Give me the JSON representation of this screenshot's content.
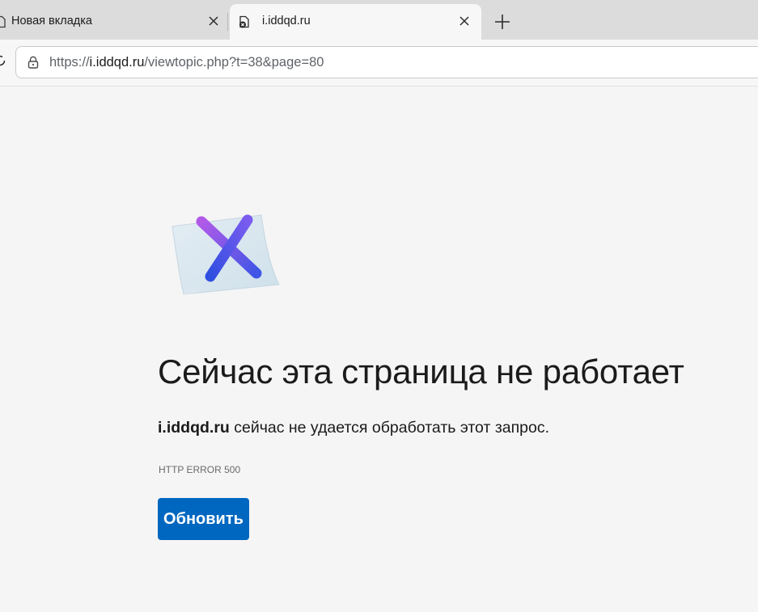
{
  "browser": {
    "tabs": [
      {
        "title": "Новая вкладка",
        "active": false,
        "icon": "page-icon"
      },
      {
        "title": "i.iddqd.ru",
        "active": true,
        "icon": "error-page-icon"
      }
    ],
    "new_tab_icon": "plus-icon",
    "address": {
      "security_icon": "lock-icon",
      "scheme": "https://",
      "host": "i.iddqd.ru",
      "path": "/viewtopic.php?t=38&page=80"
    }
  },
  "error_page": {
    "illustration": "error-x-paper-icon",
    "title": "Сейчас эта страница не работает",
    "message_host": "i.iddqd.ru",
    "message_rest": " сейчас не удается обработать этот запрос.",
    "error_code": "HTTP ERROR 500",
    "reload_label": "Обновить"
  },
  "colors": {
    "accent": "#0067c0",
    "page_background": "#f5f5f5",
    "tabstrip_background": "#dcdcdc"
  }
}
